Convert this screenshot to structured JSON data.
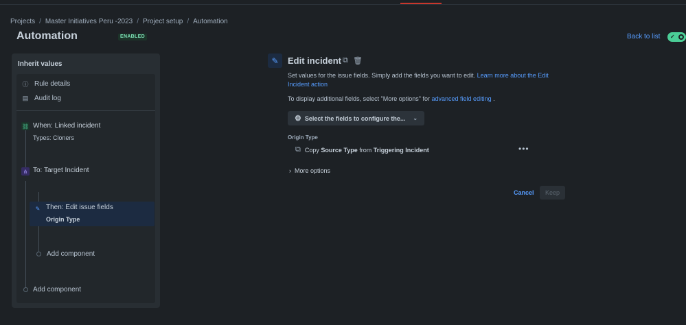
{
  "colors": {
    "background": "#1d2125",
    "accent": "#579dff",
    "enabled_badge_bg": "#1c3329",
    "enabled_badge_text": "#7ee2b8",
    "toggle_on": "#4bce97"
  },
  "breadcrumb": [
    "Projects",
    "Master Initiatives Peru -2023",
    "Project setup",
    "Automation"
  ],
  "header": {
    "title": "Automation",
    "status_badge": "ENABLED",
    "back_link": "Back to list",
    "toggle_on": true
  },
  "sidebar": {
    "heading": "Inherit values",
    "nav": [
      {
        "label": "Rule details",
        "icon": "info-icon"
      },
      {
        "label": "Audit log",
        "icon": "document-icon"
      }
    ],
    "steps": {
      "trigger": {
        "title": "When: Linked incident",
        "subtitle": "Types: Cloners",
        "icon": "link-icon"
      },
      "branch": {
        "title": "To: Target Incident",
        "icon": "hierarchy-icon"
      },
      "action": {
        "title": "Then: Edit issue fields",
        "subtitle": "Origin Type",
        "icon": "pencil-icon"
      }
    },
    "add_component_inner": "Add component",
    "add_component_outer": "Add component"
  },
  "editor": {
    "title": "Edit incident",
    "description_text": "Set values for the issue fields. Simply add the fields you want to edit.",
    "description_link": "Learn more about the Edit Incident action",
    "hint_text": "To display additional fields, select \"More options\" for",
    "hint_link": "advanced field editing",
    "hint_end": ".",
    "select_button": "Select the fields to configure the...",
    "field_label": "Origin Type",
    "field_value": {
      "prefix": "Copy",
      "source": "Source Type",
      "middle": "from",
      "target": "Triggering Incident"
    },
    "more_options": "More options",
    "cancel": "Cancel",
    "keep": "Keep"
  }
}
